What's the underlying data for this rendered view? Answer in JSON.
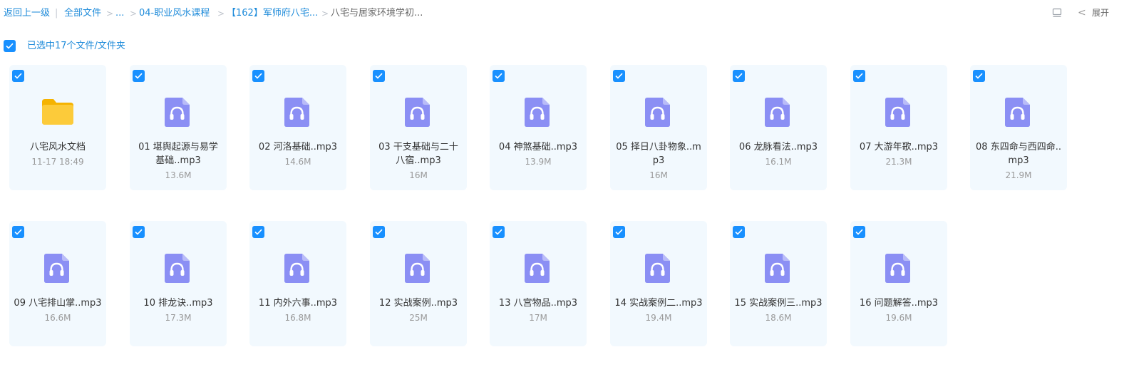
{
  "breadcrumb": {
    "back": "返回上一级",
    "sep_bar": "|",
    "all_files": "全部文件",
    "ellipsis": "...",
    "level1": "04-职业风水课程",
    "level2": "【162】军师府八宅...",
    "current": "八宅与居家环境学初...",
    "arrow": ">"
  },
  "header_right": {
    "chevron": "<",
    "expand": "展开"
  },
  "selection": {
    "text": "已选中17个文件/文件夹"
  },
  "colors": {
    "accent": "#1890ff",
    "card_bg": "#f2f9fe",
    "audio_icon": "#8b8ff4",
    "folder": "#f8c22d"
  },
  "items": [
    {
      "type": "folder",
      "name": "八宅风水文档",
      "meta": "11-17 18:49"
    },
    {
      "type": "audio",
      "name": "01 堪舆起源与易学基础..mp3",
      "meta": "13.6M"
    },
    {
      "type": "audio",
      "name": "02 河洛基础..mp3",
      "meta": "14.6M"
    },
    {
      "type": "audio",
      "name": "03 干支基础与二十八宿..mp3",
      "meta": "16M"
    },
    {
      "type": "audio",
      "name": "04 神煞基础..mp3",
      "meta": "13.9M"
    },
    {
      "type": "audio",
      "name": "05 择日八卦物象..mp3",
      "meta": "16M"
    },
    {
      "type": "audio",
      "name": "06 龙脉看法..mp3",
      "meta": "16.1M"
    },
    {
      "type": "audio",
      "name": "07 大游年歌..mp3",
      "meta": "21.3M"
    },
    {
      "type": "audio",
      "name": "08 东四命与西四命..mp3",
      "meta": "21.9M"
    },
    {
      "type": "audio",
      "name": "09 八宅排山掌..mp3",
      "meta": "16.6M"
    },
    {
      "type": "audio",
      "name": "10 排龙诀..mp3",
      "meta": "17.3M"
    },
    {
      "type": "audio",
      "name": "11 内外六事..mp3",
      "meta": "16.8M"
    },
    {
      "type": "audio",
      "name": "12 实战案例..mp3",
      "meta": "25M"
    },
    {
      "type": "audio",
      "name": "13 八宫物品..mp3",
      "meta": "17M"
    },
    {
      "type": "audio",
      "name": "14 实战案例二..mp3",
      "meta": "19.4M"
    },
    {
      "type": "audio",
      "name": "15 实战案例三..mp3",
      "meta": "18.6M"
    },
    {
      "type": "audio",
      "name": "16 问题解答..mp3",
      "meta": "19.6M"
    }
  ]
}
